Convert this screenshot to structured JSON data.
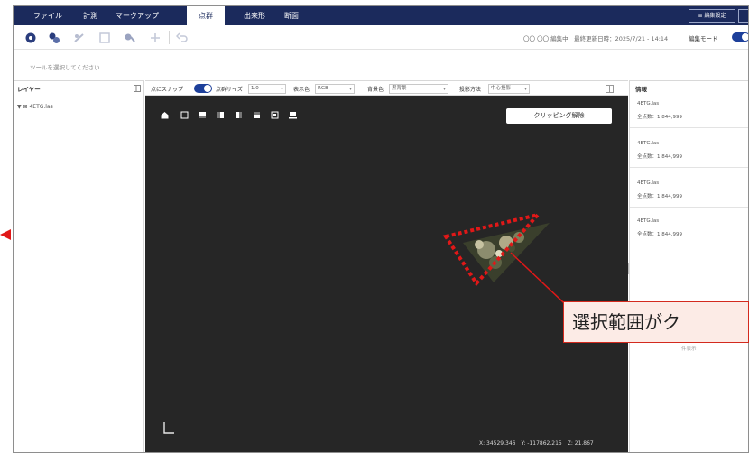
{
  "menu": {
    "tabs": [
      "ファイル",
      "計測",
      "マークアップ",
      "点群",
      "出来形",
      "断面"
    ],
    "active_index": 3,
    "right_buttons": [
      "≡ 編集設定",
      ""
    ]
  },
  "toolbar": {
    "icons": [
      "point-select-icon",
      "area-select-icon",
      "line-select-icon",
      "polygon-select-icon",
      "cut-icon",
      "add-point-icon",
      "undo-icon"
    ],
    "status": "〇〇 〇〇 編集中　最終更新日時：2025/7/21 - 14:14",
    "mode_label": "編集モード",
    "mode_on": true
  },
  "hint": "ツールを選択してください",
  "layers": {
    "title": "レイヤー",
    "items": [
      {
        "label": "▼ ⊞ 4ETG.las"
      }
    ]
  },
  "viewer": {
    "snap_label": "点にスナップ",
    "snap_on": true,
    "point_size_label": "点群サイズ",
    "point_size_value": "1.0",
    "color_label": "表示色",
    "color_value": "RGB",
    "background_label": "背景色",
    "background_value": "黒背景",
    "projection_label": "投影方法",
    "projection_value": "中心投影",
    "view_icons": [
      "home-view-icon",
      "top-view-icon",
      "front-view-icon",
      "back-view-icon",
      "left-view-icon",
      "right-view-icon",
      "bottom-view-icon",
      "ortho-view-icon"
    ],
    "clipping_button": "クリッピング解除",
    "coords": "X: 34529.346　Y: -117862.215　Z: 21.867"
  },
  "info": {
    "title": "情報",
    "cards": [
      {
        "name": "4ETG.las",
        "count": "全点数：1,844,999"
      },
      {
        "name": "4ETG.las",
        "count": "全点数：1,844,999"
      },
      {
        "name": "4ETG.las",
        "count": "全点数：1,844,999"
      },
      {
        "name": "4ETG.las",
        "count": "全点数：1,844,999"
      }
    ],
    "footer": "件表示"
  },
  "annotation": {
    "text": "選択範囲がク",
    "color": "#e01818"
  },
  "colors": {
    "menubar": "#1b2a5c",
    "accent": "#1d3f9a",
    "viewport": "#262626",
    "annotation": "#e01818"
  }
}
